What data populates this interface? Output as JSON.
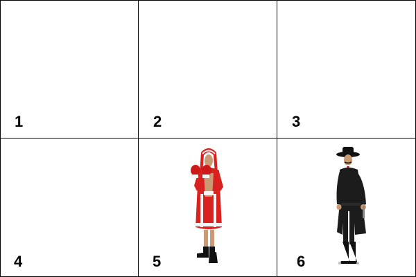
{
  "cells": [
    {
      "label": "1"
    },
    {
      "label": "2"
    },
    {
      "label": "3"
    },
    {
      "label": "4"
    },
    {
      "label": "5",
      "figure": "boxer-in-red-robe"
    },
    {
      "label": "6",
      "figure": "cowboy-gunslinger"
    }
  ],
  "colors": {
    "grid_line": "#000000",
    "robe_red": "#d9211f",
    "robe_white": "#f4f4f4",
    "coat_black": "#1c1c1c",
    "skin": "#c99a74"
  }
}
